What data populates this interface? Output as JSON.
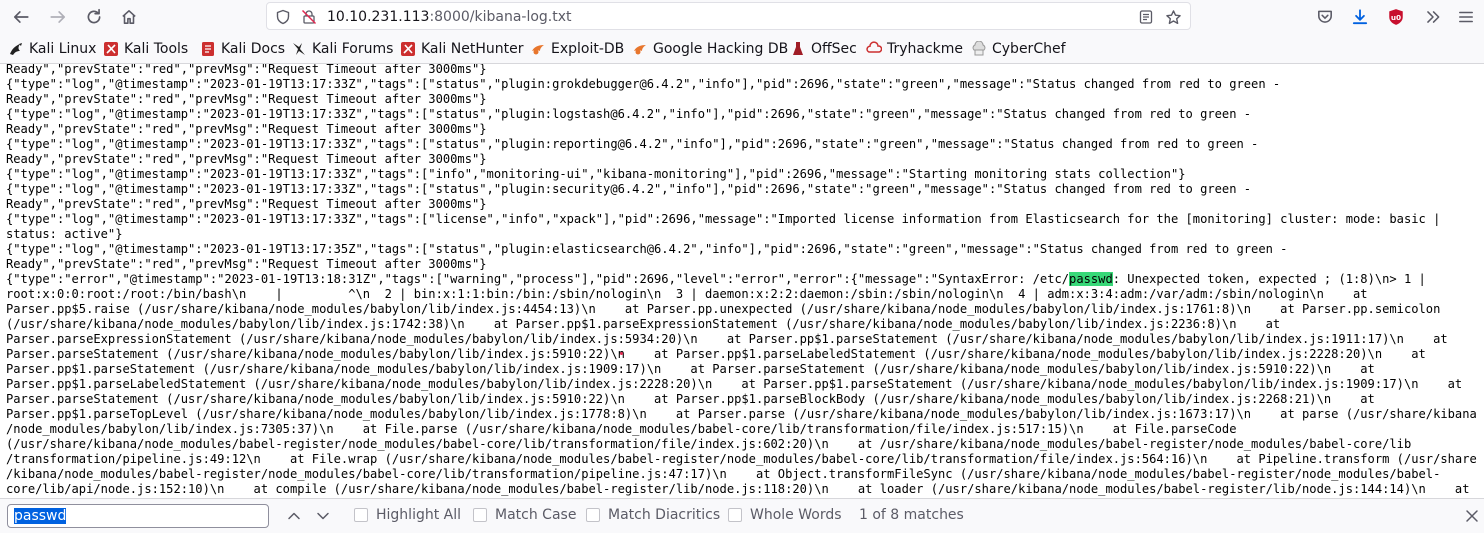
{
  "toolbar": {
    "url_host": "10.10.231.113",
    "url_rest": ":8000/kibana-log.txt"
  },
  "bookmarks": [
    {
      "label": "Kali Linux",
      "icon": "kali-dragon-icon"
    },
    {
      "label": "Kali Tools",
      "icon": "kali-tools-icon"
    },
    {
      "label": "Kali Docs",
      "icon": "kali-docs-icon"
    },
    {
      "label": "Kali Forums",
      "icon": "kali-forums-icon"
    },
    {
      "label": "Kali NetHunter",
      "icon": "kali-nethunter-icon"
    },
    {
      "label": "Exploit-DB",
      "icon": "exploit-db-icon"
    },
    {
      "label": "Google Hacking DB",
      "icon": "ghdb-icon"
    },
    {
      "label": "OffSec",
      "icon": "offsec-icon"
    },
    {
      "label": "Tryhackme",
      "icon": "tryhackme-icon"
    },
    {
      "label": "CyberChef",
      "icon": "cyberchef-icon"
    }
  ],
  "log": {
    "lines": [
      "Ready\",\"prevState\":\"red\",\"prevMsg\":\"Request Timeout after 3000ms\"}",
      "{\"type\":\"log\",\"@timestamp\":\"2023-01-19T13:17:33Z\",\"tags\":[\"status\",\"plugin:grokdebugger@6.4.2\",\"info\"],\"pid\":2696,\"state\":\"green\",\"message\":\"Status changed from red to green -",
      "Ready\",\"prevState\":\"red\",\"prevMsg\":\"Request Timeout after 3000ms\"}",
      "{\"type\":\"log\",\"@timestamp\":\"2023-01-19T13:17:33Z\",\"tags\":[\"status\",\"plugin:logstash@6.4.2\",\"info\"],\"pid\":2696,\"state\":\"green\",\"message\":\"Status changed from red to green -",
      "Ready\",\"prevState\":\"red\",\"prevMsg\":\"Request Timeout after 3000ms\"}",
      "{\"type\":\"log\",\"@timestamp\":\"2023-01-19T13:17:33Z\",\"tags\":[\"status\",\"plugin:reporting@6.4.2\",\"info\"],\"pid\":2696,\"state\":\"green\",\"message\":\"Status changed from red to green -",
      "Ready\",\"prevState\":\"red\",\"prevMsg\":\"Request Timeout after 3000ms\"}",
      "{\"type\":\"log\",\"@timestamp\":\"2023-01-19T13:17:33Z\",\"tags\":[\"info\",\"monitoring-ui\",\"kibana-monitoring\"],\"pid\":2696,\"message\":\"Starting monitoring stats collection\"}",
      "{\"type\":\"log\",\"@timestamp\":\"2023-01-19T13:17:33Z\",\"tags\":[\"status\",\"plugin:security@6.4.2\",\"info\"],\"pid\":2696,\"state\":\"green\",\"message\":\"Status changed from red to green -",
      "Ready\",\"prevState\":\"red\",\"prevMsg\":\"Request Timeout after 3000ms\"}",
      "{\"type\":\"log\",\"@timestamp\":\"2023-01-19T13:17:33Z\",\"tags\":[\"license\",\"info\",\"xpack\"],\"pid\":2696,\"message\":\"Imported license information from Elasticsearch for the [monitoring] cluster: mode: basic |",
      "status: active\"}",
      "{\"type\":\"log\",\"@timestamp\":\"2023-01-19T13:17:35Z\",\"tags\":[\"status\",\"plugin:elasticsearch@6.4.2\",\"info\"],\"pid\":2696,\"state\":\"green\",\"message\":\"Status changed from red to green -",
      "Ready\",\"prevState\":\"red\",\"prevMsg\":\"Request Timeout after 3000ms\"}",
      "root:x:0:0:root:/root:/bin/bash\\n    |         ^\\n  2 | bin:x:1:1:bin:/bin:/sbin/nologin\\n  3 | daemon:x:2:2:daemon:/sbin:/sbin/nologin\\n  4 | adm:x:3:4:adm:/var/adm:/sbin/nologin\\n    at",
      "Parser.pp$5.raise (/usr/share/kibana/node_modules/babylon/lib/index.js:4454:13)\\n    at Parser.pp.unexpected (/usr/share/kibana/node_modules/babylon/lib/index.js:1761:8)\\n    at Parser.pp.semicolon",
      "(/usr/share/kibana/node_modules/babylon/lib/index.js:1742:38)\\n    at Parser.pp$1.parseExpressionStatement (/usr/share/kibana/node_modules/babylon/lib/index.js:2236:8)\\n    at",
      "Parser.parseExpressionStatement (/usr/share/kibana/node_modules/babylon/lib/index.js:5934:20)\\n    at Parser.pp$1.parseStatement (/usr/share/kibana/node_modules/babylon/lib/index.js:1911:17)\\n    at",
      "Parser.parseStatement (/usr/share/kibana/node_modules/babylon/lib/index.js:5910:22)\\n    at Parser.pp$1.parseLabeledStatement (/usr/share/kibana/node_modules/babylon/lib/index.js:2228:20)\\n    at",
      "Parser.pp$1.parseStatement (/usr/share/kibana/node_modules/babylon/lib/index.js:1909:17)\\n    at Parser.parseStatement (/usr/share/kibana/node_modules/babylon/lib/index.js:5910:22)\\n    at",
      "Parser.pp$1.parseLabeledStatement (/usr/share/kibana/node_modules/babylon/lib/index.js:2228:20)\\n    at Parser.pp$1.parseStatement (/usr/share/kibana/node_modules/babylon/lib/index.js:1909:17)\\n    at",
      "Parser.parseStatement (/usr/share/kibana/node_modules/babylon/lib/index.js:5910:22)\\n    at Parser.pp$1.parseBlockBody (/usr/share/kibana/node_modules/babylon/lib/index.js:2268:21)\\n    at",
      "Parser.pp$1.parseTopLevel (/usr/share/kibana/node_modules/babylon/lib/index.js:1778:8)\\n    at Parser.parse (/usr/share/kibana/node_modules/babylon/lib/index.js:1673:17)\\n    at parse (/usr/share/kibana",
      "/node_modules/babylon/lib/index.js:7305:37)\\n    at File.parse (/usr/share/kibana/node_modules/babel-core/lib/transformation/file/index.js:517:15)\\n    at File.parseCode",
      "(/usr/share/kibana/node_modules/babel-register/node_modules/babel-core/lib/transformation/file/index.js:602:20)\\n    at /usr/share/kibana/node_modules/babel-register/node_modules/babel-core/lib",
      "/transformation/pipeline.js:49:12\\n    at File.wrap (/usr/share/kibana/node_modules/babel-register/node_modules/babel-core/lib/transformation/file/index.js:564:16)\\n    at Pipeline.transform (/usr/share",
      "/kibana/node_modules/babel-register/node_modules/babel-core/lib/transformation/pipeline.js:47:17)\\n    at Object.transformFileSync (/usr/share/kibana/node_modules/babel-register/node_modules/babel-",
      "core/lib/api/node.js:152:10)\\n    at compile (/usr/share/kibana/node_modules/babel-register/lib/node.js:118:20)\\n    at loader (/usr/share/kibana/node_modules/babel-register/lib/node.js:144:14)\\n    at"
    ],
    "error_line_before": "{\"type\":\"error\",\"@timestamp\":\"2023-01-19T13:18:31Z\",\"tags\":[\"warning\",\"process\"],\"pid\":2696,\"level\":\"error\",\"error\":{\"message\":\"SyntaxError: /etc/",
    "error_line_match": "passwd",
    "error_line_after": ": Unexpected token, expected ; (1:8)\\n> 1 |"
  },
  "findbar": {
    "query": "passwd",
    "highlight_all": "Highlight All",
    "match_case": "Match Case",
    "match_diacritics": "Match Diacritics",
    "whole_words": "Whole Words",
    "match_count": "1 of 8 matches"
  },
  "colors": {
    "highlight": "#38d878",
    "ublock": "#c8102e",
    "download": "#0061e0"
  }
}
